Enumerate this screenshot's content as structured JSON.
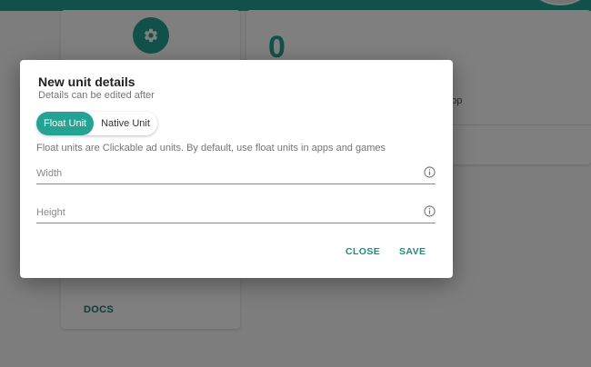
{
  "background": {
    "stat_value": "0",
    "card_text_fragment": "our app",
    "docs_label": "DOCS"
  },
  "dialog": {
    "title": "New unit details",
    "subtitle": "Details can be edited after",
    "toggle": {
      "options": [
        "Float Unit",
        "Native Unit"
      ],
      "selected": "Float Unit"
    },
    "description": "Float units are Clickable ad units. By default, use float units in apps and games",
    "fields": {
      "width": {
        "placeholder": "Width",
        "value": ""
      },
      "height": {
        "placeholder": "Height",
        "value": ""
      }
    },
    "actions": {
      "close": "CLOSE",
      "save": "SAVE"
    }
  },
  "colors": {
    "accent": "#24a394",
    "accent_text": "#1f8a7e",
    "overlay": "rgba(0,0,0,0.5)"
  },
  "icons": [
    "gear-icon",
    "info-icon"
  ]
}
